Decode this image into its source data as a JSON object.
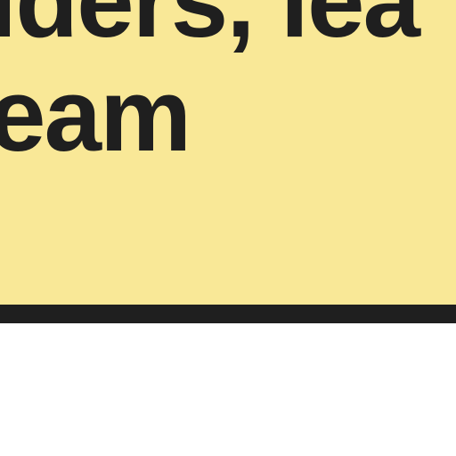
{
  "card": {
    "background": "#f9e897",
    "border_color": "#1f1f1f",
    "text_color": "#1f1f1f",
    "lines": [
      "iders, lea",
      "eam"
    ]
  }
}
